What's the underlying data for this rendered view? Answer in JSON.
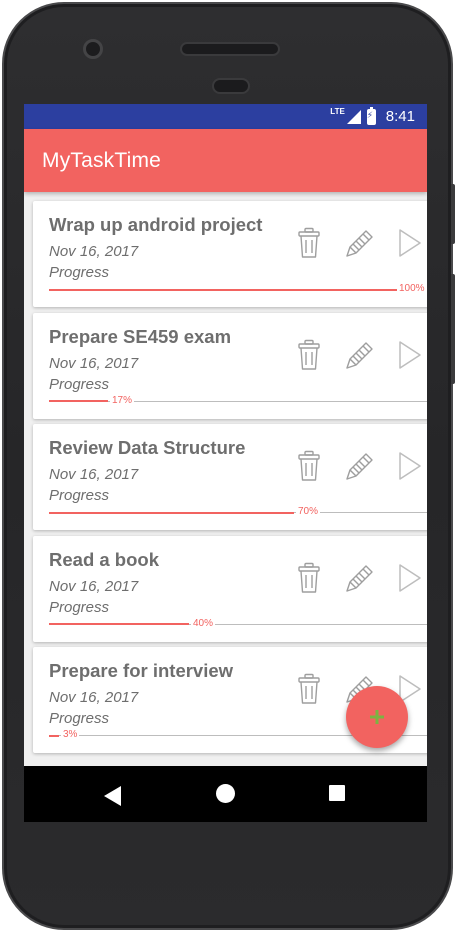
{
  "status_bar": {
    "network": "LTE",
    "time": "8:41"
  },
  "app_bar": {
    "title": "MyTaskTime"
  },
  "tasks": [
    {
      "name": "Wrap up android project",
      "date": "Nov 16, 2017",
      "progress_label": "Progress",
      "progress_text": "100%",
      "progress": 100
    },
    {
      "name": "Prepare SE459 exam",
      "date": "Nov 16, 2017",
      "progress_label": "Progress",
      "progress_text": "17%",
      "progress": 17
    },
    {
      "name": "Review Data Structure",
      "date": "Nov 16, 2017",
      "progress_label": "Progress",
      "progress_text": "70%",
      "progress": 70
    },
    {
      "name": "Read a book",
      "date": "Nov 16, 2017",
      "progress_label": "Progress",
      "progress_text": "40%",
      "progress": 40
    },
    {
      "name": "Prepare for interview",
      "date": "Nov 16, 2017",
      "progress_label": "Progress",
      "progress_text": "3%",
      "progress": 3
    }
  ],
  "task_actions": [
    "trash-icon",
    "pencil-icon",
    "play-icon"
  ],
  "fab": {
    "icon": "plus-icon",
    "icon_color": "#7cb342"
  },
  "nav_bar": {
    "icons": [
      "back-icon",
      "home-icon",
      "recent-apps-icon"
    ]
  },
  "colors": {
    "status_bar": "#2c3fa0",
    "accent": "#f26360",
    "text_secondary": "#6e6e6e"
  }
}
